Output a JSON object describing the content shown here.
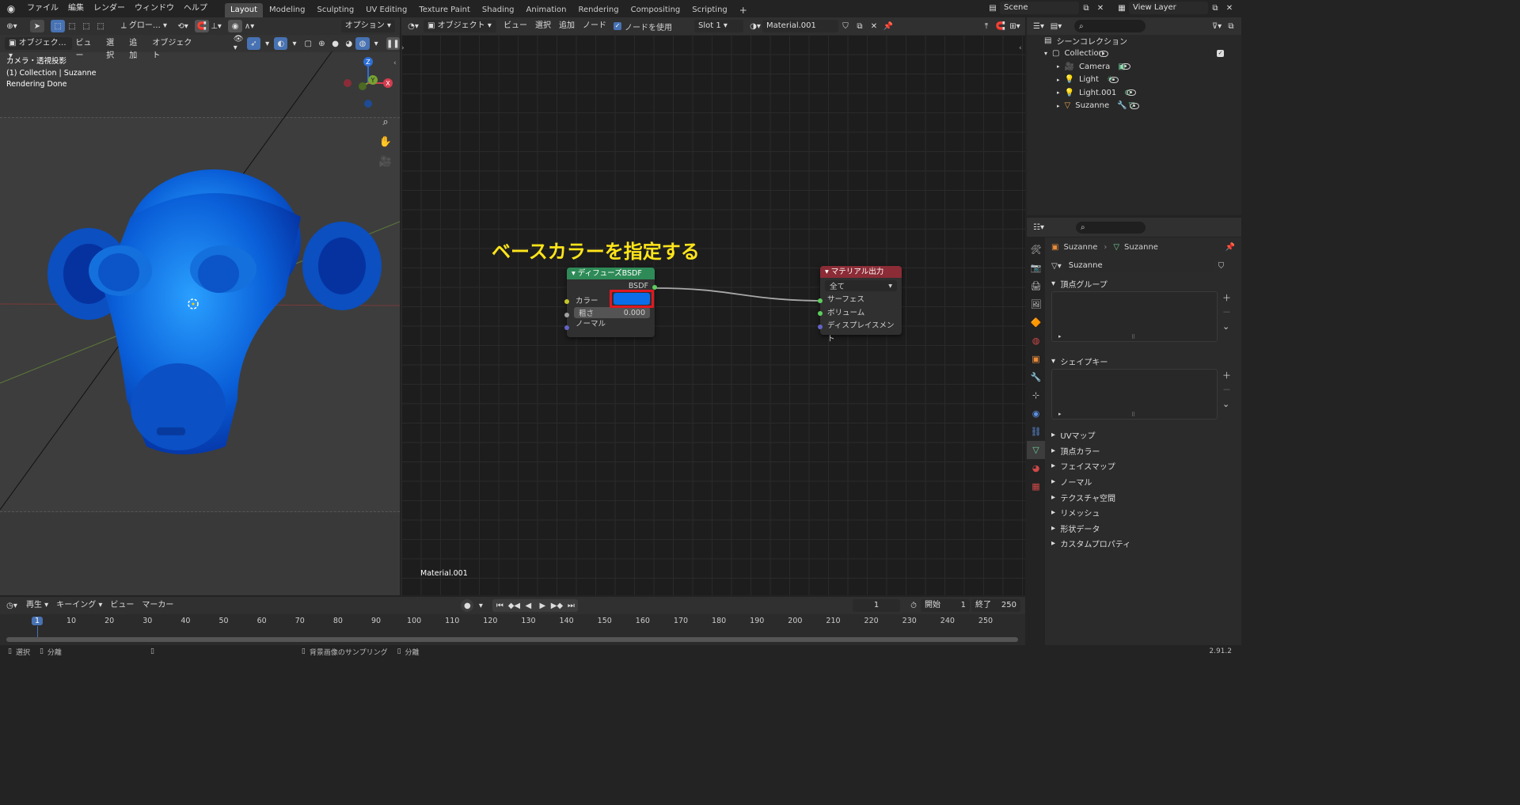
{
  "topbar": {
    "menus": [
      "ファイル",
      "編集",
      "レンダー",
      "ウィンドウ",
      "ヘルプ"
    ],
    "workspaces": [
      "Layout",
      "Modeling",
      "Sculpting",
      "UV Editing",
      "Texture Paint",
      "Shading",
      "Animation",
      "Rendering",
      "Compositing",
      "Scripting"
    ],
    "active_workspace": "Layout",
    "scene": "Scene",
    "view_layer": "View Layer"
  },
  "viewport": {
    "mode": "オブジェク…",
    "menus": [
      "ビュー",
      "選択",
      "追加",
      "オブジェクト"
    ],
    "transform": "グロー…",
    "options": "オプション",
    "info_lines": [
      "カメラ・透視投影",
      "(1) Collection | Suzanne",
      "Rendering Done"
    ],
    "gizmo": {
      "x": "X",
      "y": "Y",
      "z": "Z"
    }
  },
  "node_editor": {
    "mode": "オブジェクト",
    "menus": [
      "ビュー",
      "選択",
      "追加",
      "ノード"
    ],
    "use_nodes_label": "ノードを使用",
    "slot": "Slot 1",
    "material": "Material.001",
    "annotation": "ベースカラーを指定する",
    "footer_material": "Material.001",
    "diffuse_node": {
      "title": "ディフューズBSDF",
      "output": "BSDF",
      "color_label": "カラー",
      "color_value": "#0b6ee8",
      "roughness_label": "粗さ",
      "roughness_value": "0.000",
      "normal_label": "ノーマル"
    },
    "output_node": {
      "title": "マテリアル出力",
      "target": "全て",
      "surface": "サーフェス",
      "volume": "ボリューム",
      "displacement": "ディスプレイスメント"
    }
  },
  "outliner": {
    "root": "シーンコレクション",
    "collection": "Collection",
    "items": [
      "Camera",
      "Light",
      "Light.001",
      "Suzanne"
    ]
  },
  "properties": {
    "breadcrumb_object": "Suzanne",
    "breadcrumb_mesh": "Suzanne",
    "mesh_name": "Suzanne",
    "panels_open": [
      "頂点グループ",
      "シェイプキー"
    ],
    "panels_closed": [
      "UVマップ",
      "頂点カラー",
      "フェイスマップ",
      "ノーマル",
      "テクスチャ空間",
      "リメッシュ",
      "形状データ",
      "カスタムプロパティ"
    ]
  },
  "timeline": {
    "menus": [
      "再生",
      "キーイング",
      "ビュー",
      "マーカー"
    ],
    "current_frame": "1",
    "start_label": "開始",
    "start": "1",
    "end_label": "終了",
    "end": "250",
    "ticks": [
      "1",
      "10",
      "20",
      "30",
      "40",
      "50",
      "60",
      "70",
      "80",
      "90",
      "100",
      "110",
      "120",
      "130",
      "140",
      "150",
      "160",
      "170",
      "180",
      "190",
      "200",
      "210",
      "220",
      "230",
      "240",
      "250"
    ]
  },
  "statusbar": {
    "items": [
      "選択",
      "分離",
      "背景画像のサンプリング",
      "分離"
    ],
    "version": "2.91.2"
  }
}
